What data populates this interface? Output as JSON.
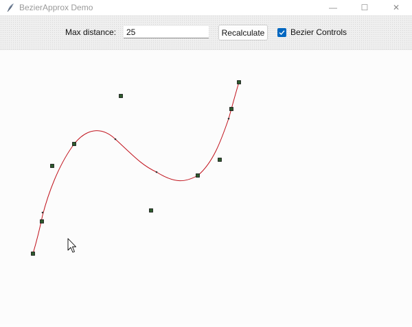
{
  "window": {
    "title": "BezierApprox Demo",
    "controls": {
      "minimize": "—",
      "maximize": "☐",
      "close": "✕"
    }
  },
  "toolbar": {
    "max_distance_label": "Max distance:",
    "max_distance_value": "25",
    "recalculate_label": "Recalculate",
    "bezier_controls_label": "Bezier Controls",
    "bezier_controls_checked": true
  },
  "colors": {
    "curve": "#c0101a",
    "point_fill": "#2d5a2d",
    "point_border": "#111111",
    "checkbox_accent": "#0067c0"
  }
}
